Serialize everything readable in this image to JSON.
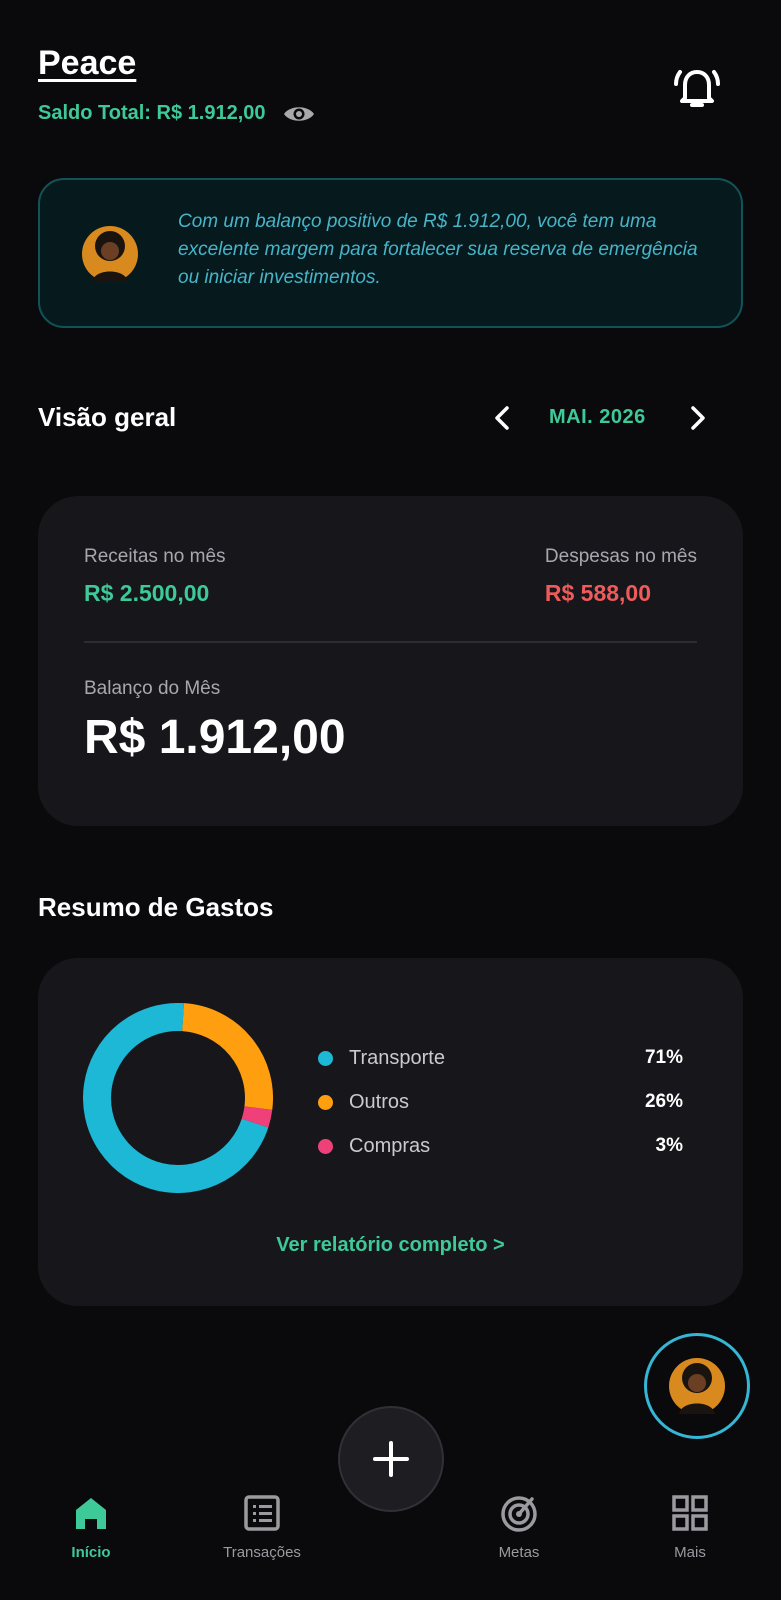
{
  "header": {
    "user_name": "Peace",
    "balance_label": "Saldo Total: R$ 1.912,00",
    "eye_icon": "eye-icon",
    "bell_icon": "bell-ringing-icon"
  },
  "insight": {
    "text": "Com um balanço positivo de R$ 1.912,00, você tem uma excelente margem para fortalecer sua reserva de emergência ou iniciar investimentos."
  },
  "overview": {
    "title": "Visão geral",
    "month": "MAI. 2026",
    "income_label": "Receitas no mês",
    "income_value": "R$ 2.500,00",
    "expense_label": "Despesas no mês",
    "expense_value": "R$ 588,00",
    "balance_label": "Balanço do Mês",
    "balance_value": "R$ 1.912,00"
  },
  "spending": {
    "title": "Resumo de Gastos",
    "report_link": "Ver relatório completo >",
    "categories": [
      {
        "name": "Transporte",
        "pct_label": "71%",
        "value": 71,
        "color": "#1cb8d6"
      },
      {
        "name": "Outros",
        "pct_label": "26%",
        "value": 26,
        "color": "#ff9f0f"
      },
      {
        "name": "Compras",
        "pct_label": "3%",
        "value": 3,
        "color": "#f0407a"
      }
    ]
  },
  "nav": {
    "items": [
      {
        "label": "Início",
        "icon": "home-icon",
        "active": true
      },
      {
        "label": "Transações",
        "icon": "list-icon",
        "active": false
      },
      {
        "label": "Metas",
        "icon": "target-icon",
        "active": false
      },
      {
        "label": "Mais",
        "icon": "grid-icon",
        "active": false
      }
    ],
    "add_icon": "plus-icon"
  },
  "colors": {
    "accent": "#3ec998",
    "expense": "#ef5b5b",
    "background": "#0a0a0c",
    "card": "#17171b"
  }
}
